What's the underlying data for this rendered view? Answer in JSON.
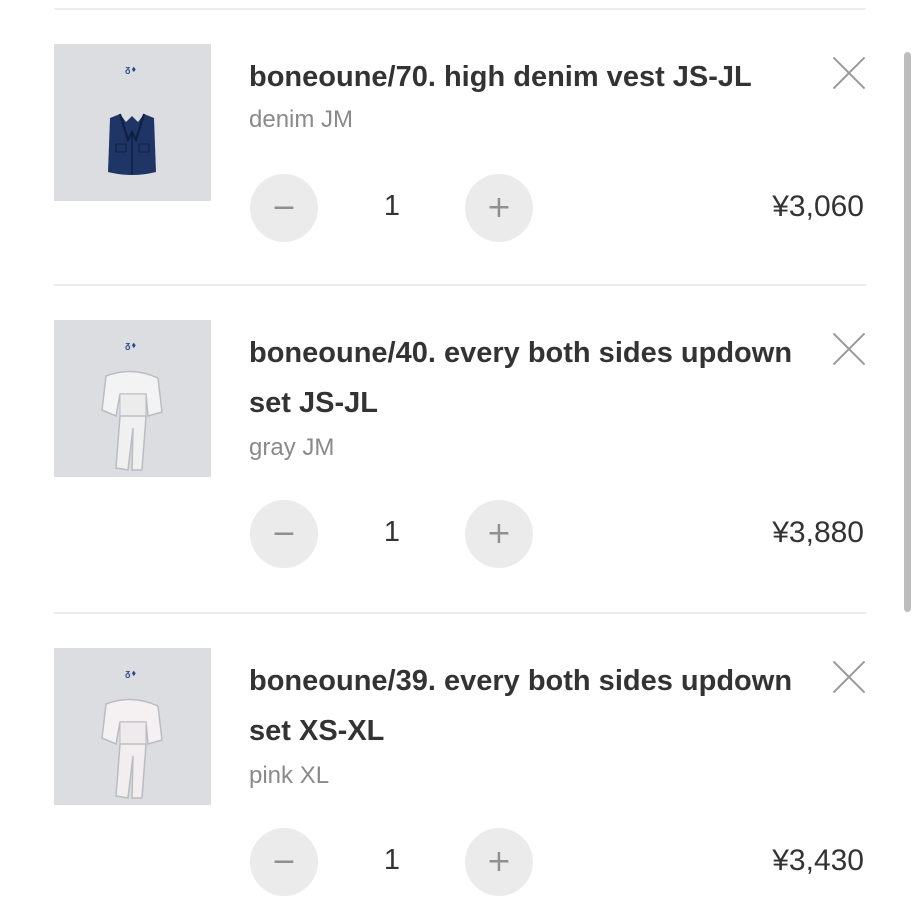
{
  "cart": {
    "items": [
      {
        "name": "boneoune/70. high denim vest JS-JL",
        "variant": "denim JM",
        "quantity": "1",
        "price": "¥3,060",
        "thumbnail_logo": "ᵹ♦",
        "minus_icon": "−",
        "plus_icon": "+",
        "remove_icon": "close-icon"
      },
      {
        "name": "boneoune/40. every both sides updown set JS-JL",
        "variant": "gray JM",
        "quantity": "1",
        "price": "¥3,880",
        "thumbnail_logo": "ᵹ♦",
        "minus_icon": "−",
        "plus_icon": "+",
        "remove_icon": "close-icon"
      },
      {
        "name": "boneoune/39. every both sides updown set XS-XL",
        "variant": "pink XL",
        "quantity": "1",
        "price": "¥3,430",
        "thumbnail_logo": "ᵹ♦",
        "minus_icon": "−",
        "plus_icon": "+",
        "remove_icon": "close-icon"
      }
    ]
  },
  "colors": {
    "background": "#ffffff",
    "text": "#333333",
    "muted": "#8a8a8a",
    "button_bg": "#ebebeb",
    "denim": "#1f3566"
  }
}
